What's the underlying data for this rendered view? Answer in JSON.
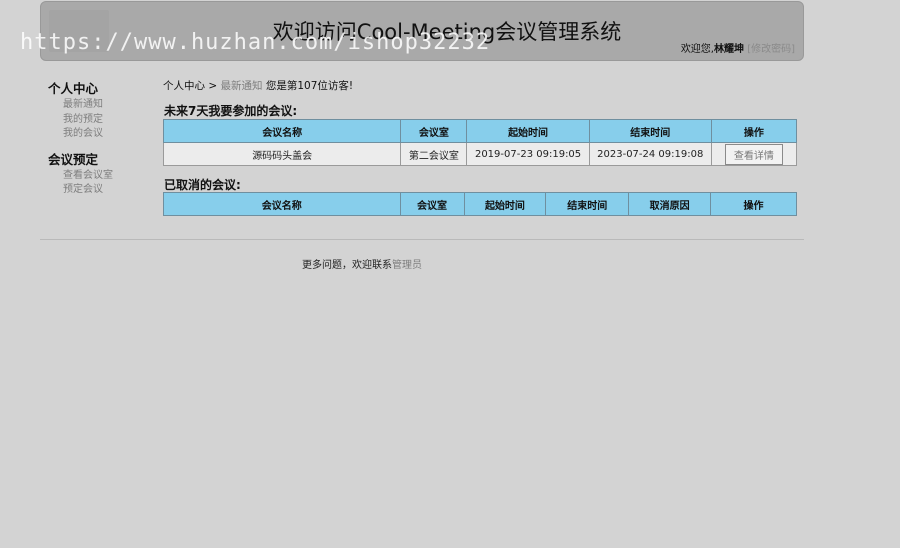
{
  "header": {
    "title": "欢迎访问Cool-Meeting会议管理系统",
    "welcome": "欢迎您,",
    "username": "林耀坤",
    "change_password": "[修改密码]",
    "watermark": "https://www.huzhan.com/ishop32232"
  },
  "sidebar": {
    "groups": [
      {
        "title": "个人中心",
        "items": [
          "最新通知",
          "我的预定",
          "我的会议"
        ]
      },
      {
        "title": "会议预定",
        "items": [
          "查看会议室",
          "预定会议"
        ]
      }
    ]
  },
  "breadcrumb": {
    "root": "个人中心",
    "sep": ">",
    "current": "最新通知",
    "visitor_text": "您是第107位访客!"
  },
  "upcoming": {
    "title": "未来7天我要参加的会议:",
    "headers": [
      "会议名称",
      "会议室",
      "起始时间",
      "结束时间",
      "操作"
    ],
    "rows": [
      {
        "name": "源码码头盖会",
        "room": "第二会议室",
        "start": "2019-07-23 09:19:05",
        "end": "2023-07-24 09:19:08",
        "action": "查看详情"
      }
    ]
  },
  "cancelled": {
    "title": "已取消的会议:",
    "headers": [
      "会议名称",
      "会议室",
      "起始时间",
      "结束时间",
      "取消原因",
      "操作"
    ]
  },
  "footer": {
    "text": "更多问题，欢迎联系",
    "link": "管理员"
  }
}
